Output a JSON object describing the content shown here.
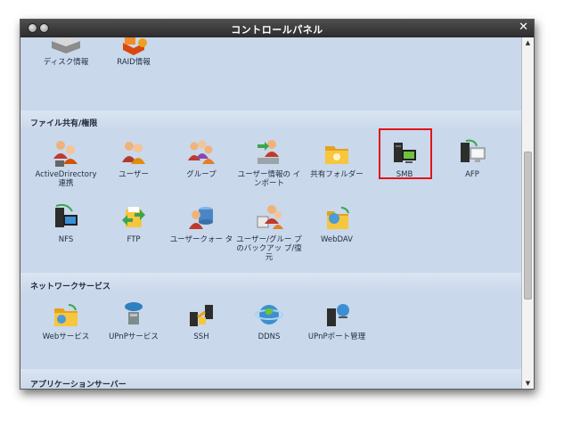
{
  "window": {
    "title": "コントロールパネル"
  },
  "sections": [
    {
      "title": "",
      "items": [
        {
          "label": "ディスク情報",
          "icon": "disk-info-icon"
        },
        {
          "label": "RAID情報",
          "icon": "raid-info-icon"
        }
      ]
    },
    {
      "title": "ファイル共有/権限",
      "items": [
        {
          "label": "ActiveDrirectory 連携",
          "icon": "active-directory-icon"
        },
        {
          "label": "ユーザー",
          "icon": "user-icon"
        },
        {
          "label": "グループ",
          "icon": "group-icon"
        },
        {
          "label": "ユーザー情報の インポート",
          "icon": "user-import-icon"
        },
        {
          "label": "共有フォルダー",
          "icon": "shared-folder-icon"
        },
        {
          "label": "SMB",
          "icon": "smb-icon"
        },
        {
          "label": "AFP",
          "icon": "afp-icon"
        },
        {
          "label": "NFS",
          "icon": "nfs-icon"
        },
        {
          "label": "FTP",
          "icon": "ftp-icon"
        },
        {
          "label": "ユーザークォー タ",
          "icon": "user-quota-icon"
        },
        {
          "label": "ユーザー/グルー プのバックアッ プ/復元",
          "icon": "backup-restore-icon"
        },
        {
          "label": "WebDAV",
          "icon": "webdav-icon"
        }
      ]
    },
    {
      "title": "ネットワークサービス",
      "items": [
        {
          "label": "Webサービス",
          "icon": "web-service-icon"
        },
        {
          "label": "UPnPサービス",
          "icon": "upnp-service-icon"
        },
        {
          "label": "SSH",
          "icon": "ssh-icon"
        },
        {
          "label": "DDNS",
          "icon": "ddns-icon"
        },
        {
          "label": "UPnPポート管理",
          "icon": "upnp-port-icon"
        }
      ]
    },
    {
      "title": "アプリケーションサーバー",
      "items": []
    }
  ],
  "colors": {
    "panel": "#c9d8ea",
    "titlebar": "#3a3a3a",
    "highlight": "#e1141b"
  }
}
